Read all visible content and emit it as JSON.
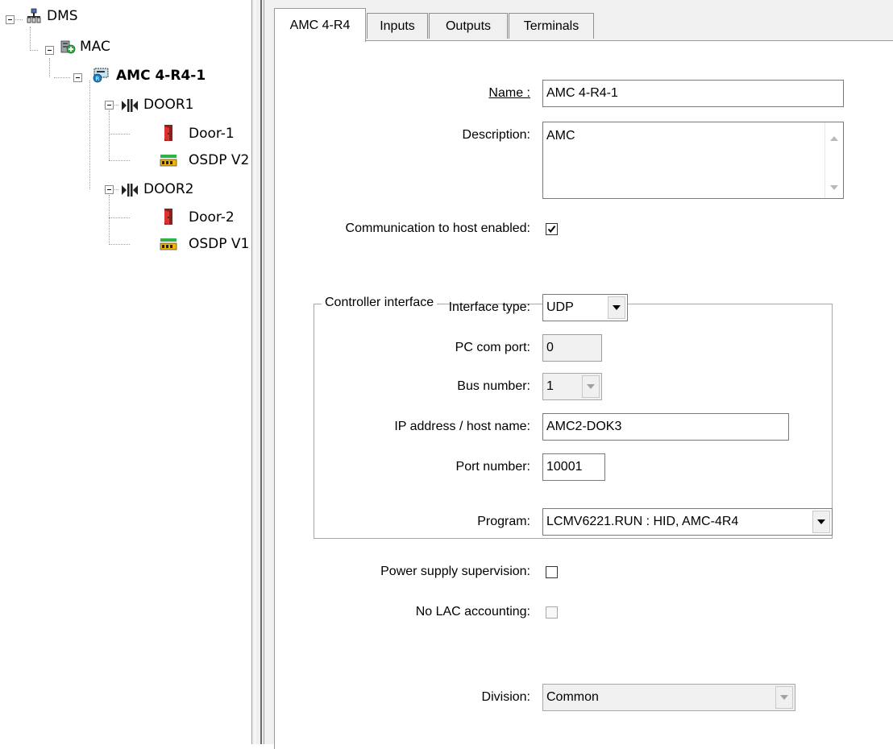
{
  "tree": {
    "root": "DMS",
    "mac": "MAC",
    "controller": "AMC 4-R4-1",
    "door1": "DOOR1",
    "door1_entrance": "Door-1",
    "door1_reader": "OSDP V2",
    "door2": "DOOR2",
    "door2_entrance": "Door-2",
    "door2_reader": "OSDP V1"
  },
  "tabs": [
    "AMC 4-R4",
    "Inputs",
    "Outputs",
    "Terminals"
  ],
  "form": {
    "name_label": "Name :",
    "name_value": "AMC 4-R4-1",
    "description_label": "Description:",
    "description_value": "AMC",
    "comm_label": "Communication to host enabled:",
    "comm_checked": true,
    "group_title": "Controller interface",
    "interface_type_label": "Interface type:",
    "interface_type_value": "UDP",
    "pc_com_port_label": "PC com port:",
    "pc_com_port_value": "0",
    "bus_number_label": "Bus number:",
    "bus_number_value": "1",
    "ip_label": "IP address / host name:",
    "ip_value": "AMC2-DOK3",
    "port_label": "Port number:",
    "port_value": "10001",
    "program_label": "Program:",
    "program_value": "LCMV6221.RUN : HID, AMC-4R4",
    "power_label": "Power supply supervision:",
    "power_checked": false,
    "lac_label": "No LAC accounting:",
    "lac_checked": false,
    "division_label": "Division:",
    "division_value": "Common"
  }
}
